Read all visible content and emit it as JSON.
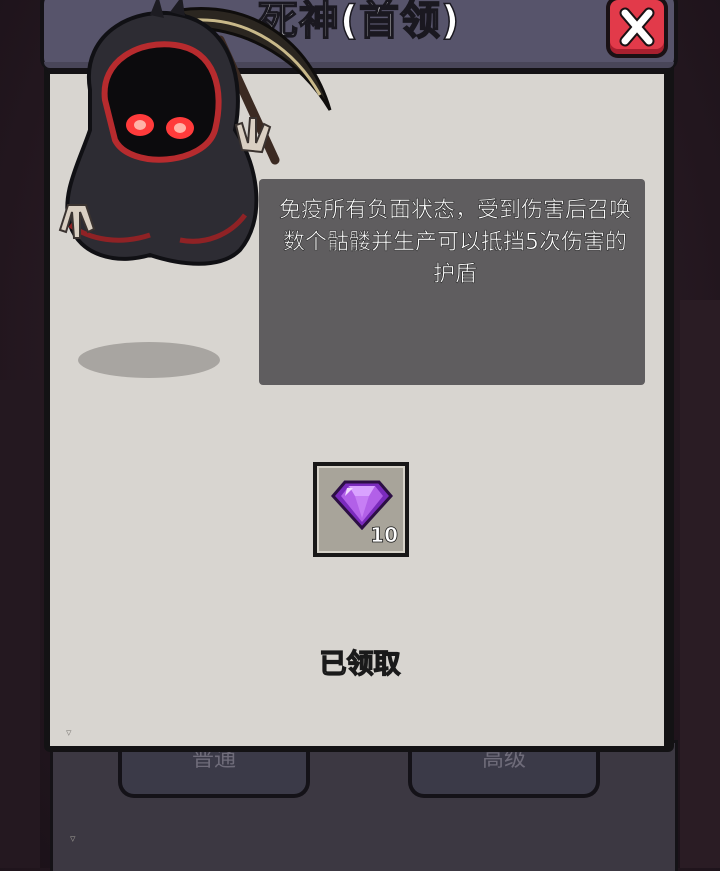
{
  "dialog": {
    "title": "死神(首领)",
    "description": "免疫所有负面状态，受到伤害后召唤数个骷髅并生产可以抵挡5次伤害的护盾",
    "reward": {
      "icon": "purple-gem-icon",
      "count": "10"
    },
    "status": "已领取",
    "close_icon": "close-icon"
  },
  "background_buttons": {
    "normal_label": "普通",
    "advanced_label": "高级"
  },
  "colors": {
    "title_bar": "#57546b",
    "close_button": "#e23a4a",
    "panel_body": "#d8d5d0",
    "description_box": "#5f5d5f",
    "gem": "#b260e8"
  }
}
